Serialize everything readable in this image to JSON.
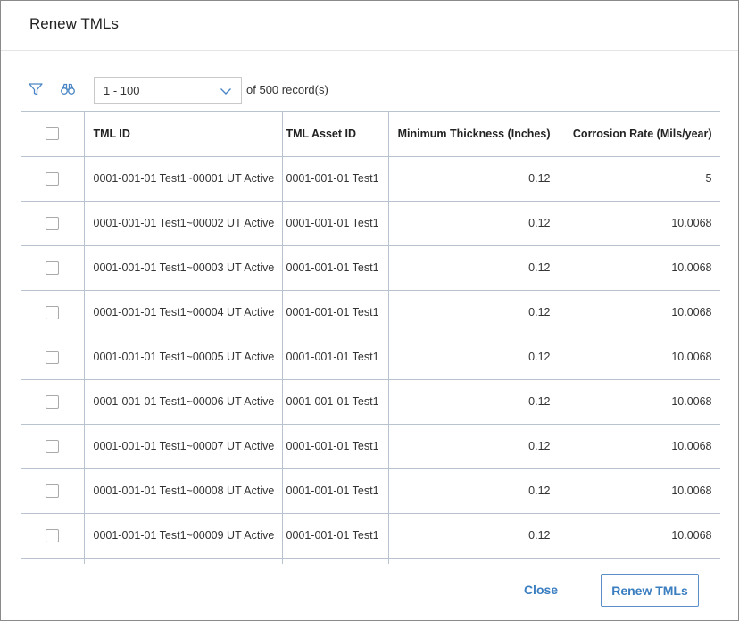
{
  "dialog": {
    "title": "Renew TMLs"
  },
  "toolbar": {
    "filter_icon": "filter-icon",
    "find_icon": "binoculars-icon",
    "range_value": "1 - 100",
    "of_label": "of",
    "total_records": "500",
    "records_label": "record(s)"
  },
  "table": {
    "columns": [
      "TML ID",
      "TML Asset ID",
      "Minimum Thickness (Inches)",
      "Corrosion Rate (Mils/year)"
    ],
    "rows": [
      {
        "tml_id": "0001-001-01 Test1~00001 UT Active",
        "asset_id": "0001-001-01 Test1",
        "min_thickness": "0.12",
        "corrosion_rate": "5"
      },
      {
        "tml_id": "0001-001-01 Test1~00002 UT Active",
        "asset_id": "0001-001-01 Test1",
        "min_thickness": "0.12",
        "corrosion_rate": "10.0068"
      },
      {
        "tml_id": "0001-001-01 Test1~00003 UT Active",
        "asset_id": "0001-001-01 Test1",
        "min_thickness": "0.12",
        "corrosion_rate": "10.0068"
      },
      {
        "tml_id": "0001-001-01 Test1~00004 UT Active",
        "asset_id": "0001-001-01 Test1",
        "min_thickness": "0.12",
        "corrosion_rate": "10.0068"
      },
      {
        "tml_id": "0001-001-01 Test1~00005 UT Active",
        "asset_id": "0001-001-01 Test1",
        "min_thickness": "0.12",
        "corrosion_rate": "10.0068"
      },
      {
        "tml_id": "0001-001-01 Test1~00006 UT Active",
        "asset_id": "0001-001-01 Test1",
        "min_thickness": "0.12",
        "corrosion_rate": "10.0068"
      },
      {
        "tml_id": "0001-001-01 Test1~00007 UT Active",
        "asset_id": "0001-001-01 Test1",
        "min_thickness": "0.12",
        "corrosion_rate": "10.0068"
      },
      {
        "tml_id": "0001-001-01 Test1~00008 UT Active",
        "asset_id": "0001-001-01 Test1",
        "min_thickness": "0.12",
        "corrosion_rate": "10.0068"
      },
      {
        "tml_id": "0001-001-01 Test1~00009 UT Active",
        "asset_id": "0001-001-01 Test1",
        "min_thickness": "0.12",
        "corrosion_rate": "10.0068"
      },
      {
        "tml_id": "",
        "asset_id": "",
        "min_thickness": "",
        "corrosion_rate": ""
      }
    ]
  },
  "footer": {
    "close_label": "Close",
    "renew_label": "Renew TMLs"
  },
  "colors": {
    "accent": "#3a7ec0",
    "grid_line": "#b9c3cf"
  }
}
